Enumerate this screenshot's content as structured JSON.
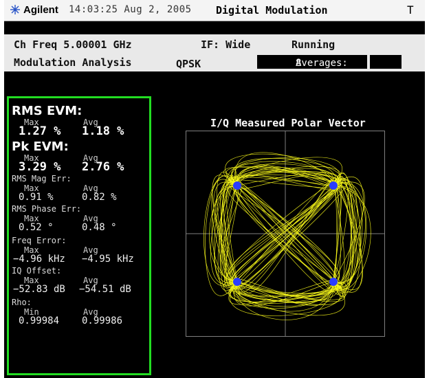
{
  "header": {
    "brand": "Agilent",
    "time": "14:03:25  Aug 2, 2005",
    "mode": "Digital Modulation",
    "trigger_indicator": "T",
    "logo_icon": "agilent-spark-icon"
  },
  "status": {
    "ch_freq": "Ch Freq 5.00001 GHz",
    "if_mode": "IF: Wide",
    "run_state": "Running",
    "measurement": "Modulation Analysis",
    "modulation": "QPSK",
    "averages_label": "Averages:",
    "averages_value": "8"
  },
  "metrics": {
    "rms_evm": {
      "title": "RMS EVM:",
      "max_label": "Max",
      "avg_label": "Avg",
      "max": "1.27 %",
      "avg": "1.18 %"
    },
    "pk_evm": {
      "title": "Pk EVM:",
      "max_label": "Max",
      "avg_label": "Avg",
      "max": "3.29 %",
      "avg": "2.76 %"
    },
    "rms_mag_err": {
      "title": "RMS Mag Err:",
      "max_label": "Max",
      "avg_label": "Avg",
      "max": "0.91 %",
      "avg": "0.82 %"
    },
    "rms_phase_err": {
      "title": "RMS Phase Err:",
      "max_label": "Max",
      "avg_label": "Avg",
      "max": "0.52 °",
      "avg": "0.48 °"
    },
    "freq_error": {
      "title": "Freq Error:",
      "max_label": "Max",
      "avg_label": "Avg",
      "max": "−4.96 kHz",
      "avg": "−4.95 kHz"
    },
    "iq_offset": {
      "title": "IQ Offset:",
      "max_label": "Max",
      "avg_label": "Avg",
      "max": "−52.83 dB",
      "avg": "−54.51 dB"
    },
    "rho": {
      "title": "Rho:",
      "min_label": "Min",
      "avg_label": "Avg",
      "min": "0.99984",
      "avg": "0.99986"
    }
  },
  "plot": {
    "title": "I/Q Measured Polar Vector",
    "trace_color": "#f5f51a",
    "symbol_color": "#2a3cff",
    "grid_color": "#888888"
  },
  "colors": {
    "panel_border": "#22dd22",
    "background": "#000000"
  }
}
